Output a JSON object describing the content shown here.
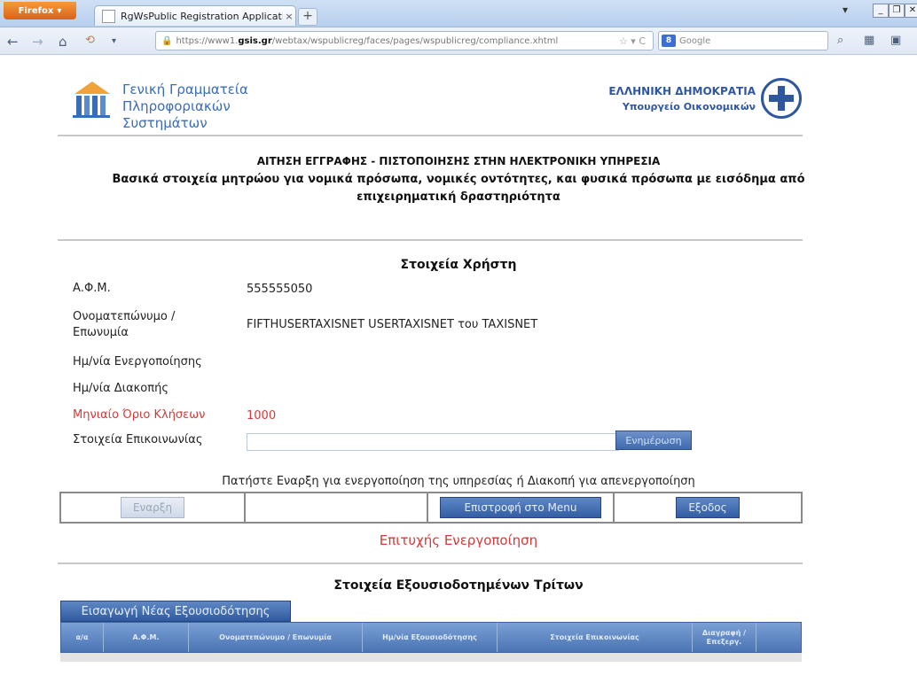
{
  "browser": {
    "firefox_label": "Firefox",
    "tab_title": "RgWsPublic Registration Application ...",
    "tab_close": "×",
    "new_tab": "+",
    "url_prefix": "https://www1.",
    "url_domain": "gsis.gr",
    "url_path": "/webtax/wspublicreg/faces/pages/wspublicreg/compliance.xhtml",
    "search_placeholder": "Google",
    "search_engine_letter": "8"
  },
  "header": {
    "left_logo_line1": "Γενική Γραμματεία",
    "left_logo_line2": "Πληροφοριακών Συστημάτων",
    "right_line1": "ΕΛΛΗΝΙΚΗ ΔΗΜΟΚΡΑΤΙΑ",
    "right_line2": "Υπουργείο Οικονομικών"
  },
  "title": {
    "line1": "ΑΙΤΗΣΗ ΕΓΓΡΑΦΗΣ - ΠΙΣΤΟΠΟΙΗΣΗΣ ΣΤΗΝ ΗΛΕΚΤΡΟΝΙΚΗ ΥΠΗΡΕΣΙΑ",
    "line2": "Βασικά στοιχεία μητρώου για νομικά πρόσωπα, νομικές οντότητες, και φυσικά πρόσωπα με εισόδημα από",
    "line3": "επιχειρηματική δραστηριότητα"
  },
  "user_section": {
    "title": "Στοιχεία Χρήστη",
    "afm_label": "Α.Φ.Μ.",
    "afm_value": "555555050",
    "name_label_1": "Ονοματεπώνυμο /",
    "name_label_2": "Επωνυμία",
    "name_value": "FIFTHUSERTAXISNET USERTAXISNET του TAXISNET",
    "activation_label": "Ημ/νία Ενεργοποίησης",
    "deactivation_label": "Ημ/νία Διακοπής",
    "monthly_limit_label": "Μηνιαίο Όριο Κλήσεων",
    "monthly_limit_value": "1000",
    "contact_label": "Στοιχεία Επικοινωνίας",
    "contact_value": "",
    "update_button": "Ενημέρωση"
  },
  "controls": {
    "instruction": "Πατήστε Εναρξη για ενεργοποίηση της υπηρεσίας ή Διακοπή για απενεργοποίηση",
    "start_button": "Εναρξη",
    "menu_button": "Επιστροφή στο Menu",
    "exit_button": "Εξοδος",
    "success_message": "Επιτυχής Ενεργοποίηση"
  },
  "third_parties": {
    "title": "Στοιχεία Εξουσιοδοτημένων Τρίτων",
    "new_button": "Εισαγωγή Νέας Εξουσιοδότησης",
    "columns": [
      "α/α",
      "Α.Φ.Μ.",
      "Ονοματεπώνυμο / Επωνυμία",
      "Ημ/νία Εξουσιοδότησης",
      "Στοιχεία Επικοινωνίας",
      "Διαγραφή / Επεξεργ."
    ]
  }
}
